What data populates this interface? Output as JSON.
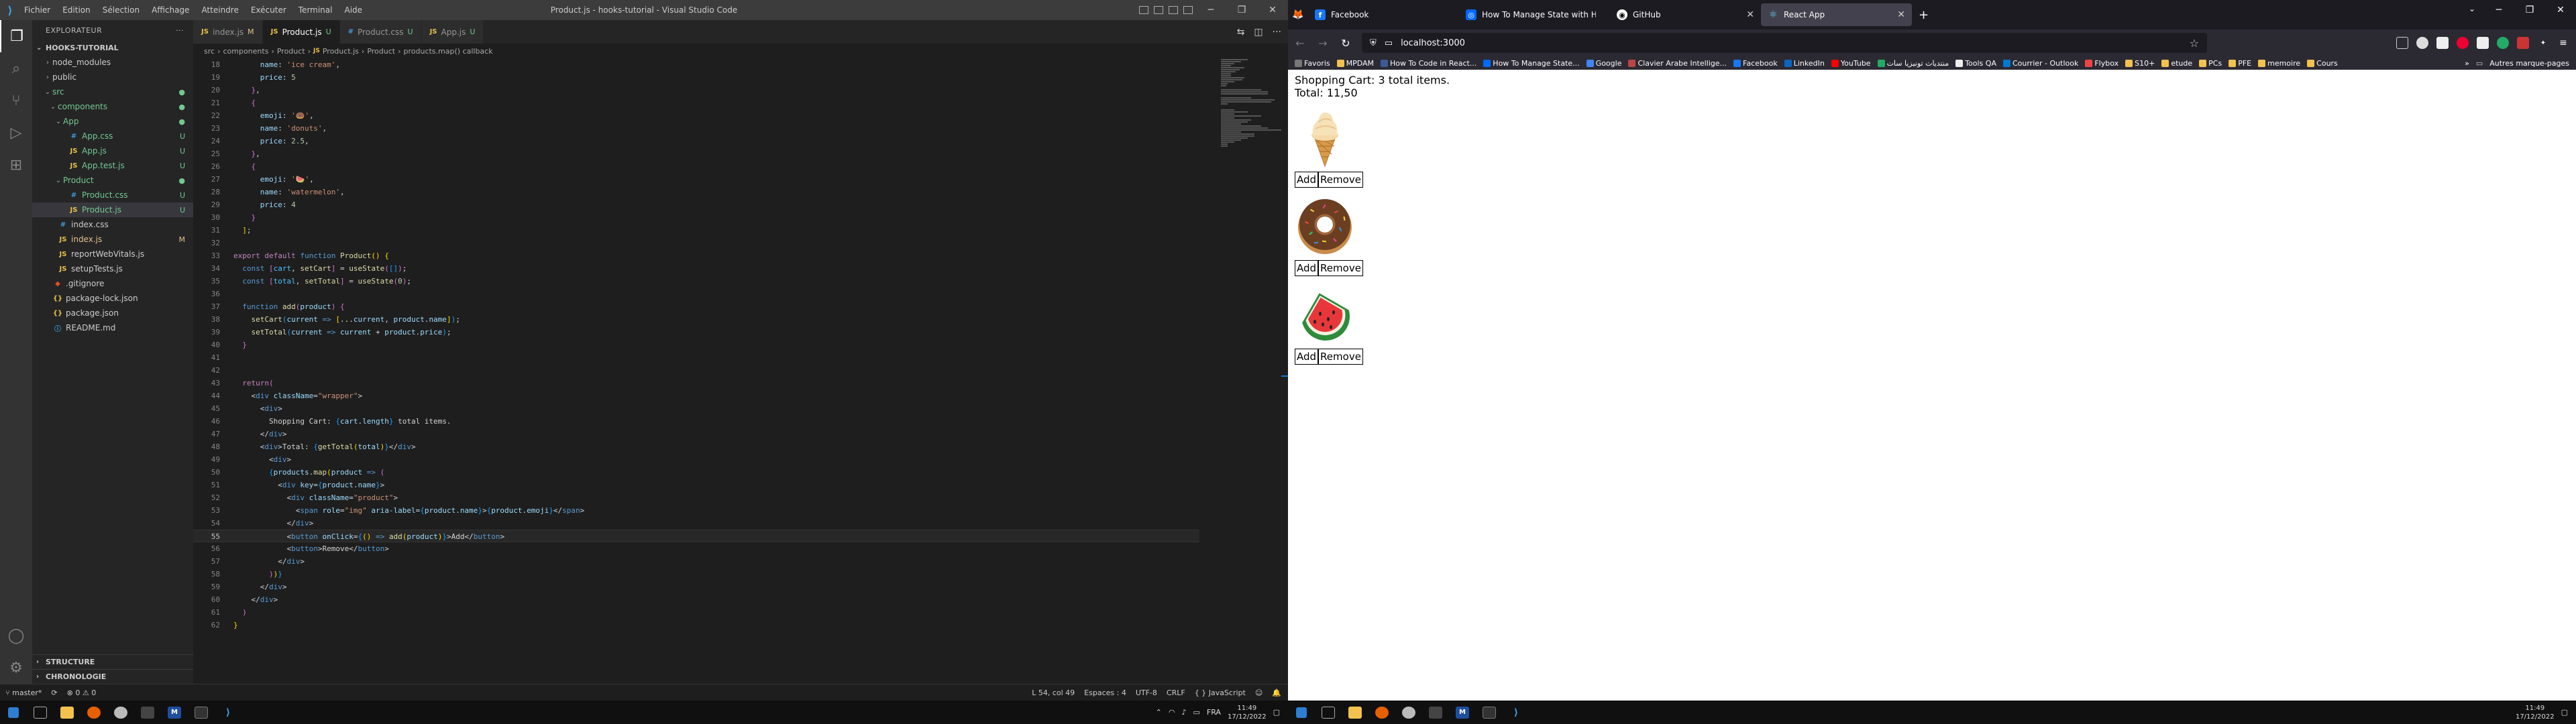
{
  "vscode": {
    "title": "Product.js - hooks-tutorial - Visual Studio Code",
    "menu": [
      "Fichier",
      "Edition",
      "Sélection",
      "Affichage",
      "Atteindre",
      "Exécuter",
      "Terminal",
      "Aide"
    ],
    "sidebar": {
      "header": "EXPLORATEUR",
      "project": "HOOKS-TUTORIAL",
      "tree": [
        {
          "label": "node_modules",
          "type": "folder",
          "depth": 1,
          "open": false,
          "badge": ""
        },
        {
          "label": "public",
          "type": "folder",
          "depth": 1,
          "open": false,
          "badge": ""
        },
        {
          "label": "src",
          "type": "folder",
          "depth": 1,
          "open": true,
          "badge": "●",
          "color": "green"
        },
        {
          "label": "components",
          "type": "folder",
          "depth": 2,
          "open": true,
          "badge": "●",
          "color": "green"
        },
        {
          "label": "App",
          "type": "folder",
          "depth": 3,
          "open": true,
          "badge": "●",
          "color": "green"
        },
        {
          "label": "App.css",
          "type": "css",
          "depth": 4,
          "badge": "U",
          "color": "green"
        },
        {
          "label": "App.js",
          "type": "js",
          "depth": 4,
          "badge": "U",
          "color": "green"
        },
        {
          "label": "App.test.js",
          "type": "js",
          "depth": 4,
          "badge": "U",
          "color": "green"
        },
        {
          "label": "Product",
          "type": "folder",
          "depth": 3,
          "open": true,
          "badge": "●",
          "color": "green"
        },
        {
          "label": "Product.css",
          "type": "css",
          "depth": 4,
          "badge": "U",
          "color": "green"
        },
        {
          "label": "Product.js",
          "type": "js",
          "depth": 4,
          "badge": "U",
          "color": "green",
          "selected": true
        },
        {
          "label": "index.css",
          "type": "css",
          "depth": 2,
          "badge": ""
        },
        {
          "label": "index.js",
          "type": "js",
          "depth": 2,
          "badge": "M",
          "color": "mod"
        },
        {
          "label": "reportWebVitals.js",
          "type": "js",
          "depth": 2,
          "badge": ""
        },
        {
          "label": "setupTests.js",
          "type": "js",
          "depth": 2,
          "badge": ""
        },
        {
          "label": ".gitignore",
          "type": "git",
          "depth": 1,
          "badge": ""
        },
        {
          "label": "package-lock.json",
          "type": "json",
          "depth": 1,
          "badge": ""
        },
        {
          "label": "package.json",
          "type": "json",
          "depth": 1,
          "badge": ""
        },
        {
          "label": "README.md",
          "type": "md",
          "depth": 1,
          "badge": ""
        }
      ],
      "bottom_sections": [
        "STRUCTURE",
        "CHRONOLOGIE"
      ]
    },
    "tabs": [
      {
        "label": "index.js",
        "status": "M",
        "type": "js",
        "active": false
      },
      {
        "label": "Product.js",
        "status": "U",
        "type": "js",
        "active": true
      },
      {
        "label": "Product.css",
        "status": "U",
        "type": "css",
        "active": false
      },
      {
        "label": "App.js",
        "status": "U",
        "type": "js",
        "active": false
      }
    ],
    "breadcrumb": [
      "src",
      "components",
      "Product",
      "Product.js",
      "Product",
      "products.map() callback"
    ],
    "status": {
      "branch": "master*",
      "errors": "⊗ 0  ⚠ 0",
      "position": "L 54, col 49",
      "spaces": "Espaces : 4",
      "encoding": "UTF-8",
      "eol": "CRLF",
      "language": "JavaScript"
    }
  },
  "firefox": {
    "tabs": [
      {
        "title": "Facebook",
        "favicon": "f",
        "color": "#1877f2",
        "active": false
      },
      {
        "title": "How To Manage State with Hooks on React Components",
        "favicon": "◎",
        "color": "#0069ff",
        "active": false
      },
      {
        "title": "GitHub",
        "favicon": "◉",
        "color": "#ffffff",
        "active": false
      },
      {
        "title": "React App",
        "favicon": "⚛",
        "color": "#61dafb",
        "active": true
      }
    ],
    "url": "localhost:3000",
    "bookmarks": [
      "Favoris",
      "MPDAM",
      "How To Code in React...",
      "How To Manage State...",
      "Google",
      "Clavier Arabe Intellige...",
      "Facebook",
      "LinkedIn",
      "YouTube",
      "منتديات تونيزيا سات",
      "Tools QA",
      "Courrier - Outlook",
      "Flybox",
      "S10+",
      "etude",
      "PCs",
      "PFE",
      "memoire",
      "Cours"
    ],
    "bookmarks_more": "Autres marque-pages",
    "page": {
      "cart_text": "Shopping Cart: 3 total items.",
      "total_text": "Total: 11,50",
      "products": [
        {
          "name": "ice cream",
          "emoji": "🍦",
          "add": "Add",
          "remove": "Remove"
        },
        {
          "name": "donuts",
          "emoji": "🍩",
          "add": "Add",
          "remove": "Remove"
        },
        {
          "name": "watermelon",
          "emoji": "🍉",
          "add": "Add",
          "remove": "Remove"
        }
      ]
    }
  },
  "taskbar": {
    "time": "11:49",
    "date": "17/12/2022",
    "lang": "FRA"
  }
}
